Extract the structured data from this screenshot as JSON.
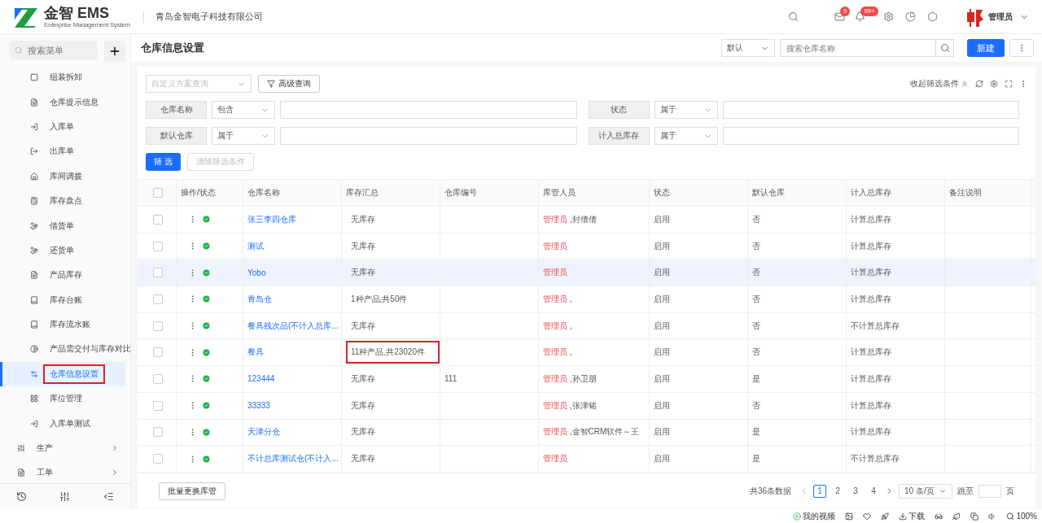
{
  "header": {
    "logo_text": "金智 EMS",
    "logo_subtitle": "Enterprise Management System",
    "company": "青岛金智电子科技有限公司",
    "badges": [
      {
        "count": "9"
      },
      {
        "count": "99+"
      }
    ],
    "user": "管理员"
  },
  "sidebar": {
    "search_placeholder": "搜索菜单",
    "items": [
      {
        "label": "组装拆卸",
        "kind": "child",
        "selected": false,
        "annotated": false
      },
      {
        "label": "仓库提示信息",
        "kind": "child",
        "selected": false,
        "annotated": false
      },
      {
        "label": "入库单",
        "kind": "child",
        "selected": false,
        "annotated": false
      },
      {
        "label": "出库单",
        "kind": "child",
        "selected": false,
        "annotated": false
      },
      {
        "label": "库间调拨",
        "kind": "child",
        "selected": false,
        "annotated": false
      },
      {
        "label": "库存盘点",
        "kind": "child",
        "selected": false,
        "annotated": false
      },
      {
        "label": "借货单",
        "kind": "child",
        "selected": false,
        "annotated": false
      },
      {
        "label": "还货单",
        "kind": "child",
        "selected": false,
        "annotated": false
      },
      {
        "label": "产品库存",
        "kind": "child",
        "selected": false,
        "annotated": false
      },
      {
        "label": "库存台账",
        "kind": "child",
        "selected": false,
        "annotated": false
      },
      {
        "label": "库存流水账",
        "kind": "child",
        "selected": false,
        "annotated": false
      },
      {
        "label": "产品需交付与库存对比",
        "kind": "child",
        "selected": false,
        "annotated": false
      },
      {
        "label": "仓库信息设置",
        "kind": "child",
        "selected": true,
        "annotated": true
      },
      {
        "label": "库位管理",
        "kind": "child",
        "selected": false,
        "annotated": false
      },
      {
        "label": "入库单测试",
        "kind": "child",
        "selected": false,
        "annotated": false
      },
      {
        "label": "生产",
        "kind": "group",
        "selected": false,
        "annotated": false
      },
      {
        "label": "工单",
        "kind": "group",
        "selected": false,
        "annotated": false
      }
    ]
  },
  "page": {
    "title": "仓库信息设置",
    "view": "默认",
    "search_placeholder": "搜索仓库名称",
    "new_button": "新建"
  },
  "filter": {
    "scheme_placeholder": "自定义方案查询",
    "advanced": "高级查询",
    "collapse": "收起筛选条件",
    "fields": [
      {
        "label": "仓库名称",
        "operator": "包含"
      },
      {
        "label": "状态",
        "operator": "属于"
      },
      {
        "label": "默认仓库",
        "operator": "属于"
      },
      {
        "label": "计入总库存",
        "operator": "属于"
      }
    ],
    "apply": "筛 选",
    "clear": {
      "label": "清除筛选条件",
      "disabled": true
    }
  },
  "table": {
    "all_checked": false,
    "columns": [
      "操作/状态",
      "仓库名称",
      "库存汇总",
      "仓库编号",
      "库管人员",
      "状态",
      "默认仓库",
      "计入总库存",
      "备注说明"
    ],
    "rows": [
      {
        "selected": false,
        "checked": false,
        "name": "张三李四仓库",
        "stock": "无库存",
        "stock_annotated": false,
        "code": "",
        "manager": "管理员",
        "manager_rest": " ,封倩倩",
        "status": "启用",
        "default": "否",
        "total": "计算总库存"
      },
      {
        "selected": false,
        "checked": false,
        "name": "测试",
        "stock": "无库存",
        "stock_annotated": false,
        "code": "",
        "manager": "管理员",
        "manager_rest": "",
        "status": "启用",
        "default": "否",
        "total": "计算总库存"
      },
      {
        "selected": true,
        "checked": false,
        "name": "Yobo",
        "stock": "无库存",
        "stock_annotated": false,
        "code": "",
        "manager": "管理员",
        "manager_rest": "",
        "status": "启用",
        "default": "否",
        "total": "计算总库存"
      },
      {
        "selected": false,
        "checked": false,
        "name": "青岛仓",
        "stock": "1种产品,共50件",
        "stock_annotated": false,
        "code": "",
        "manager": "管理员",
        "manager_rest": " ,",
        "status": "启用",
        "default": "否",
        "total": "计算总库存"
      },
      {
        "selected": false,
        "checked": false,
        "name": "餐具残次品(不计入总库...",
        "stock": "无库存",
        "stock_annotated": false,
        "code": "",
        "manager": "管理员",
        "manager_rest": " ,",
        "status": "启用",
        "default": "否",
        "total": "不计算总库存"
      },
      {
        "selected": false,
        "checked": false,
        "name": "餐具",
        "stock": "11种产品,共23020件",
        "stock_annotated": true,
        "code": "",
        "manager": "管理员",
        "manager_rest": " ,",
        "status": "启用",
        "default": "否",
        "total": "计算总库存"
      },
      {
        "selected": false,
        "checked": false,
        "name": "123444",
        "stock": "无库存",
        "stock_annotated": false,
        "code": "111",
        "manager": "管理员",
        "manager_rest": " ,孙卫朋",
        "status": "启用",
        "default": "是",
        "total": "计算总库存"
      },
      {
        "selected": false,
        "checked": false,
        "name": "33333",
        "stock": "无库存",
        "stock_annotated": false,
        "code": "",
        "manager": "管理员",
        "manager_rest": " ,张津铭",
        "status": "启用",
        "default": "否",
        "total": "计算总库存"
      },
      {
        "selected": false,
        "checked": false,
        "name": "天津分仓",
        "stock": "无库存",
        "stock_annotated": false,
        "code": "",
        "manager": "管理员",
        "manager_rest": " ,金智CRM软件～王",
        "status": "启用",
        "default": "是",
        "total": "计算总库存"
      },
      {
        "selected": false,
        "checked": false,
        "name": "不计总库测试仓(不计入...",
        "stock": "无库存",
        "stock_annotated": false,
        "code": "",
        "manager": "管理员",
        "manager_rest": "",
        "status": "启用",
        "default": "是",
        "total": "不计算总库存"
      }
    ]
  },
  "footer": {
    "batch": "批量更换库管",
    "total": "共36条数据",
    "pages": [
      {
        "label": "1",
        "selected": true
      },
      {
        "label": "2",
        "selected": false
      },
      {
        "label": "3",
        "selected": false
      },
      {
        "label": "4",
        "selected": false
      }
    ],
    "page_size": "10 条/页",
    "jump": "跳至",
    "page_unit": "页"
  },
  "status_bar": {
    "video": "我的视频",
    "download": "下载",
    "zoom": "100%"
  }
}
